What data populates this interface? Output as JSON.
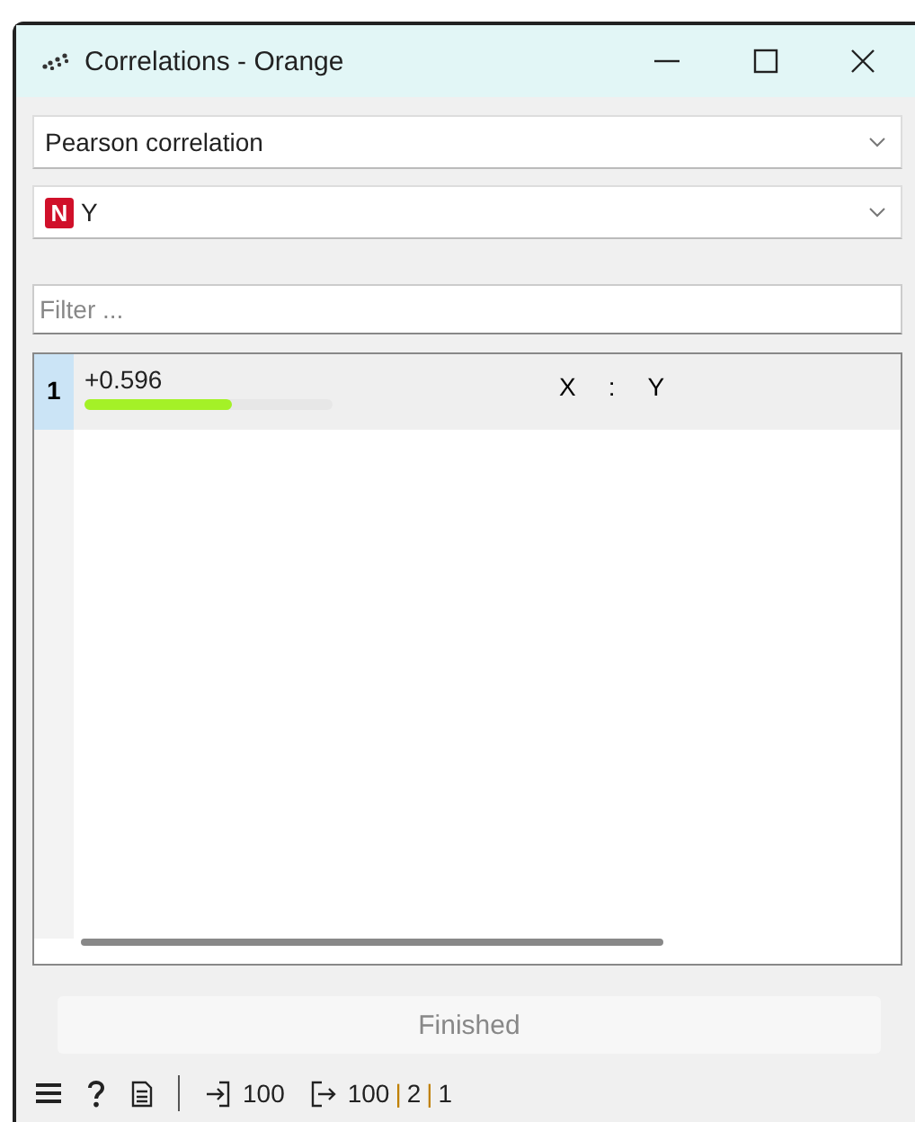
{
  "window": {
    "title": "Correlations - Orange"
  },
  "correlation_type": {
    "value": "Pearson correlation"
  },
  "feature": {
    "badge": "N",
    "value": "Y"
  },
  "filter": {
    "placeholder": "Filter ..."
  },
  "table": {
    "rows": [
      {
        "number": "1",
        "value": "+0.596",
        "level": 0.596,
        "pair": [
          "X",
          ":",
          "Y"
        ]
      }
    ]
  },
  "status": {
    "text": "Finished"
  },
  "status_bar": {
    "input": "100",
    "output": [
      {
        "text": "100",
        "kind": "count"
      },
      {
        "text": "|",
        "kind": "separator"
      },
      {
        "text": "2",
        "kind": "count"
      },
      {
        "text": "|",
        "kind": "separator"
      },
      {
        "text": "1",
        "kind": "count"
      }
    ]
  }
}
